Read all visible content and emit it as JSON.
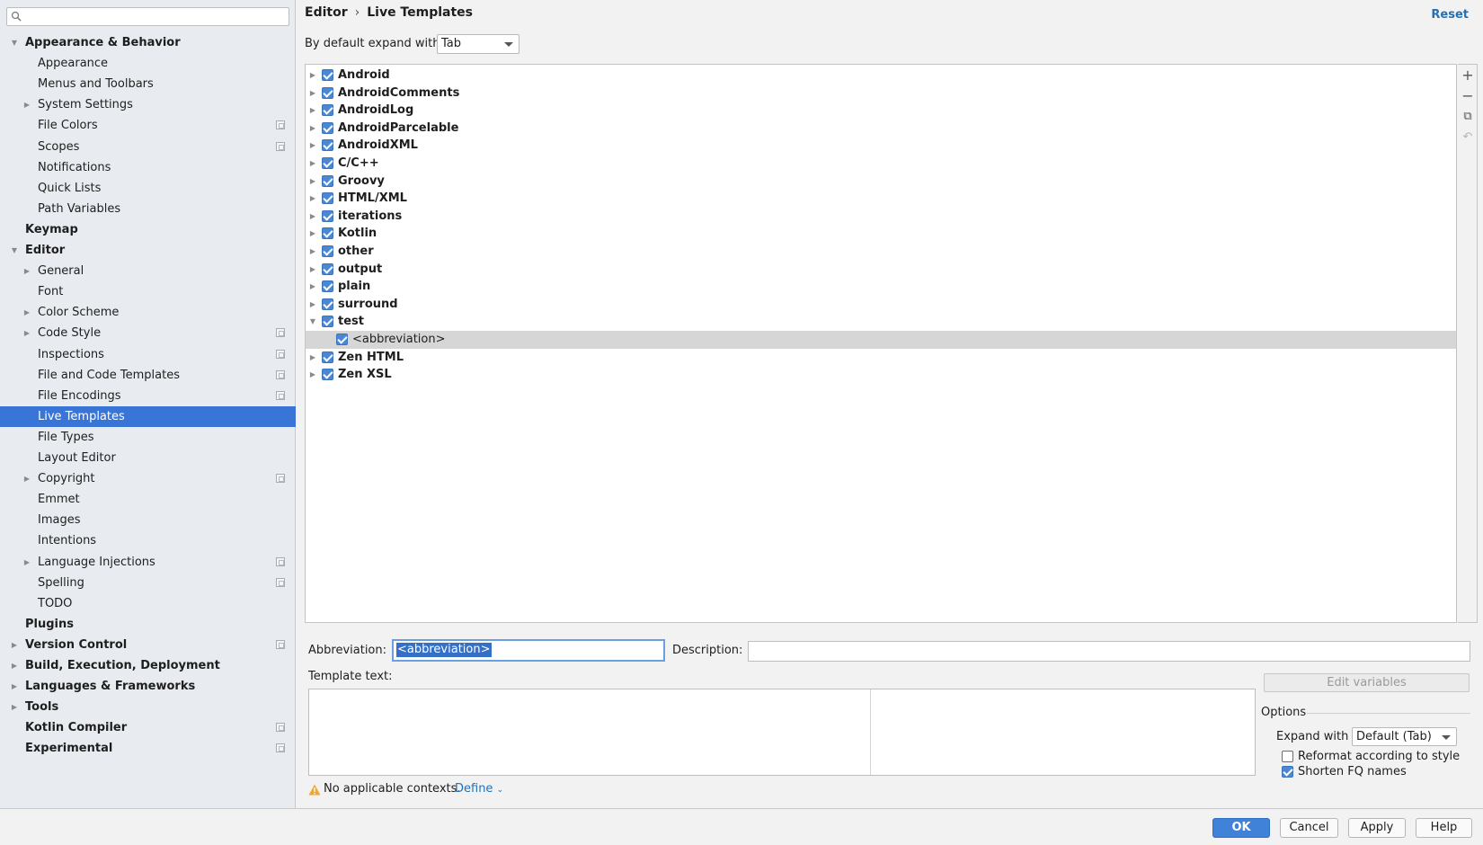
{
  "search": {
    "placeholder": "",
    "value": ""
  },
  "sidebar": {
    "items": [
      {
        "label": "Appearance & Behavior",
        "level": 0,
        "bold": true,
        "expanded": true,
        "has_children": true,
        "project_icon": false
      },
      {
        "label": "Appearance",
        "level": 1,
        "bold": false,
        "has_children": false,
        "project_icon": false
      },
      {
        "label": "Menus and Toolbars",
        "level": 1,
        "bold": false,
        "has_children": false,
        "project_icon": false
      },
      {
        "label": "System Settings",
        "level": 1,
        "bold": false,
        "has_children": true,
        "expanded": false,
        "project_icon": false
      },
      {
        "label": "File Colors",
        "level": 1,
        "bold": false,
        "has_children": false,
        "project_icon": true
      },
      {
        "label": "Scopes",
        "level": 1,
        "bold": false,
        "has_children": false,
        "project_icon": true
      },
      {
        "label": "Notifications",
        "level": 1,
        "bold": false,
        "has_children": false,
        "project_icon": false
      },
      {
        "label": "Quick Lists",
        "level": 1,
        "bold": false,
        "has_children": false,
        "project_icon": false
      },
      {
        "label": "Path Variables",
        "level": 1,
        "bold": false,
        "has_children": false,
        "project_icon": false
      },
      {
        "label": "Keymap",
        "level": 0,
        "bold": true,
        "has_children": false,
        "project_icon": false
      },
      {
        "label": "Editor",
        "level": 0,
        "bold": true,
        "expanded": true,
        "has_children": true,
        "project_icon": false
      },
      {
        "label": "General",
        "level": 1,
        "bold": false,
        "has_children": true,
        "expanded": false,
        "project_icon": false
      },
      {
        "label": "Font",
        "level": 1,
        "bold": false,
        "has_children": false,
        "project_icon": false
      },
      {
        "label": "Color Scheme",
        "level": 1,
        "bold": false,
        "has_children": true,
        "expanded": false,
        "project_icon": false
      },
      {
        "label": "Code Style",
        "level": 1,
        "bold": false,
        "has_children": true,
        "expanded": false,
        "project_icon": true
      },
      {
        "label": "Inspections",
        "level": 1,
        "bold": false,
        "has_children": false,
        "project_icon": true
      },
      {
        "label": "File and Code Templates",
        "level": 1,
        "bold": false,
        "has_children": false,
        "project_icon": true
      },
      {
        "label": "File Encodings",
        "level": 1,
        "bold": false,
        "has_children": false,
        "project_icon": true
      },
      {
        "label": "Live Templates",
        "level": 1,
        "bold": false,
        "has_children": false,
        "project_icon": false,
        "selected": true
      },
      {
        "label": "File Types",
        "level": 1,
        "bold": false,
        "has_children": false,
        "project_icon": false
      },
      {
        "label": "Layout Editor",
        "level": 1,
        "bold": false,
        "has_children": false,
        "project_icon": false
      },
      {
        "label": "Copyright",
        "level": 1,
        "bold": false,
        "has_children": true,
        "expanded": false,
        "project_icon": true
      },
      {
        "label": "Emmet",
        "level": 1,
        "bold": false,
        "has_children": false,
        "project_icon": false
      },
      {
        "label": "Images",
        "level": 1,
        "bold": false,
        "has_children": false,
        "project_icon": false
      },
      {
        "label": "Intentions",
        "level": 1,
        "bold": false,
        "has_children": false,
        "project_icon": false
      },
      {
        "label": "Language Injections",
        "level": 1,
        "bold": false,
        "has_children": true,
        "expanded": false,
        "project_icon": true
      },
      {
        "label": "Spelling",
        "level": 1,
        "bold": false,
        "has_children": false,
        "project_icon": true
      },
      {
        "label": "TODO",
        "level": 1,
        "bold": false,
        "has_children": false,
        "project_icon": false
      },
      {
        "label": "Plugins",
        "level": 0,
        "bold": true,
        "has_children": false,
        "project_icon": false
      },
      {
        "label": "Version Control",
        "level": 0,
        "bold": true,
        "has_children": true,
        "expanded": false,
        "project_icon": true
      },
      {
        "label": "Build, Execution, Deployment",
        "level": 0,
        "bold": true,
        "has_children": true,
        "expanded": false,
        "project_icon": false
      },
      {
        "label": "Languages & Frameworks",
        "level": 0,
        "bold": true,
        "has_children": true,
        "expanded": false,
        "project_icon": false
      },
      {
        "label": "Tools",
        "level": 0,
        "bold": true,
        "has_children": true,
        "expanded": false,
        "project_icon": false
      },
      {
        "label": "Kotlin Compiler",
        "level": 0,
        "bold": true,
        "has_children": false,
        "project_icon": true
      },
      {
        "label": "Experimental",
        "level": 0,
        "bold": true,
        "has_children": false,
        "project_icon": true
      }
    ]
  },
  "breadcrumb": {
    "parent": "Editor",
    "separator": "›",
    "current": "Live Templates"
  },
  "reset_label": "Reset",
  "expand_default": {
    "label": "By default expand with",
    "value": "Tab"
  },
  "template_groups": [
    {
      "label": "Android",
      "checked": true,
      "expanded": false,
      "level": 0
    },
    {
      "label": "AndroidComments",
      "checked": true,
      "expanded": false,
      "level": 0
    },
    {
      "label": "AndroidLog",
      "checked": true,
      "expanded": false,
      "level": 0
    },
    {
      "label": "AndroidParcelable",
      "checked": true,
      "expanded": false,
      "level": 0
    },
    {
      "label": "AndroidXML",
      "checked": true,
      "expanded": false,
      "level": 0
    },
    {
      "label": "C/C++",
      "checked": true,
      "expanded": false,
      "level": 0
    },
    {
      "label": "Groovy",
      "checked": true,
      "expanded": false,
      "level": 0
    },
    {
      "label": "HTML/XML",
      "checked": true,
      "expanded": false,
      "level": 0
    },
    {
      "label": "iterations",
      "checked": true,
      "expanded": false,
      "level": 0
    },
    {
      "label": "Kotlin",
      "checked": true,
      "expanded": false,
      "level": 0
    },
    {
      "label": "other",
      "checked": true,
      "expanded": false,
      "level": 0
    },
    {
      "label": "output",
      "checked": true,
      "expanded": false,
      "level": 0
    },
    {
      "label": "plain",
      "checked": true,
      "expanded": false,
      "level": 0
    },
    {
      "label": "surround",
      "checked": true,
      "expanded": false,
      "level": 0
    },
    {
      "label": "test",
      "checked": true,
      "expanded": true,
      "level": 0
    },
    {
      "label": "<abbreviation>",
      "checked": true,
      "level": 1,
      "selected": true
    },
    {
      "label": "Zen HTML",
      "checked": true,
      "expanded": false,
      "level": 0
    },
    {
      "label": "Zen XSL",
      "checked": true,
      "expanded": false,
      "level": 0
    }
  ],
  "toolbar": {
    "add": "+",
    "remove": "−",
    "copy": "⧉",
    "restore": "↶"
  },
  "abbreviation": {
    "label": "Abbreviation:",
    "value": "<abbreviation>"
  },
  "description": {
    "label": "Description:",
    "value": ""
  },
  "template_text": {
    "label": "Template text:",
    "value": ""
  },
  "edit_variables_label": "Edit variables",
  "options": {
    "title": "Options",
    "expand_with_label": "Expand with",
    "expand_with_value": "Default (Tab)",
    "reformat": {
      "label": "Reformat according to style",
      "checked": false
    },
    "shorten": {
      "label": "Shorten FQ names",
      "checked": true
    }
  },
  "context": {
    "message": "No applicable contexts.",
    "define_label": "Define"
  },
  "footer": {
    "ok": "OK",
    "cancel": "Cancel",
    "apply": "Apply",
    "help": "Help"
  }
}
